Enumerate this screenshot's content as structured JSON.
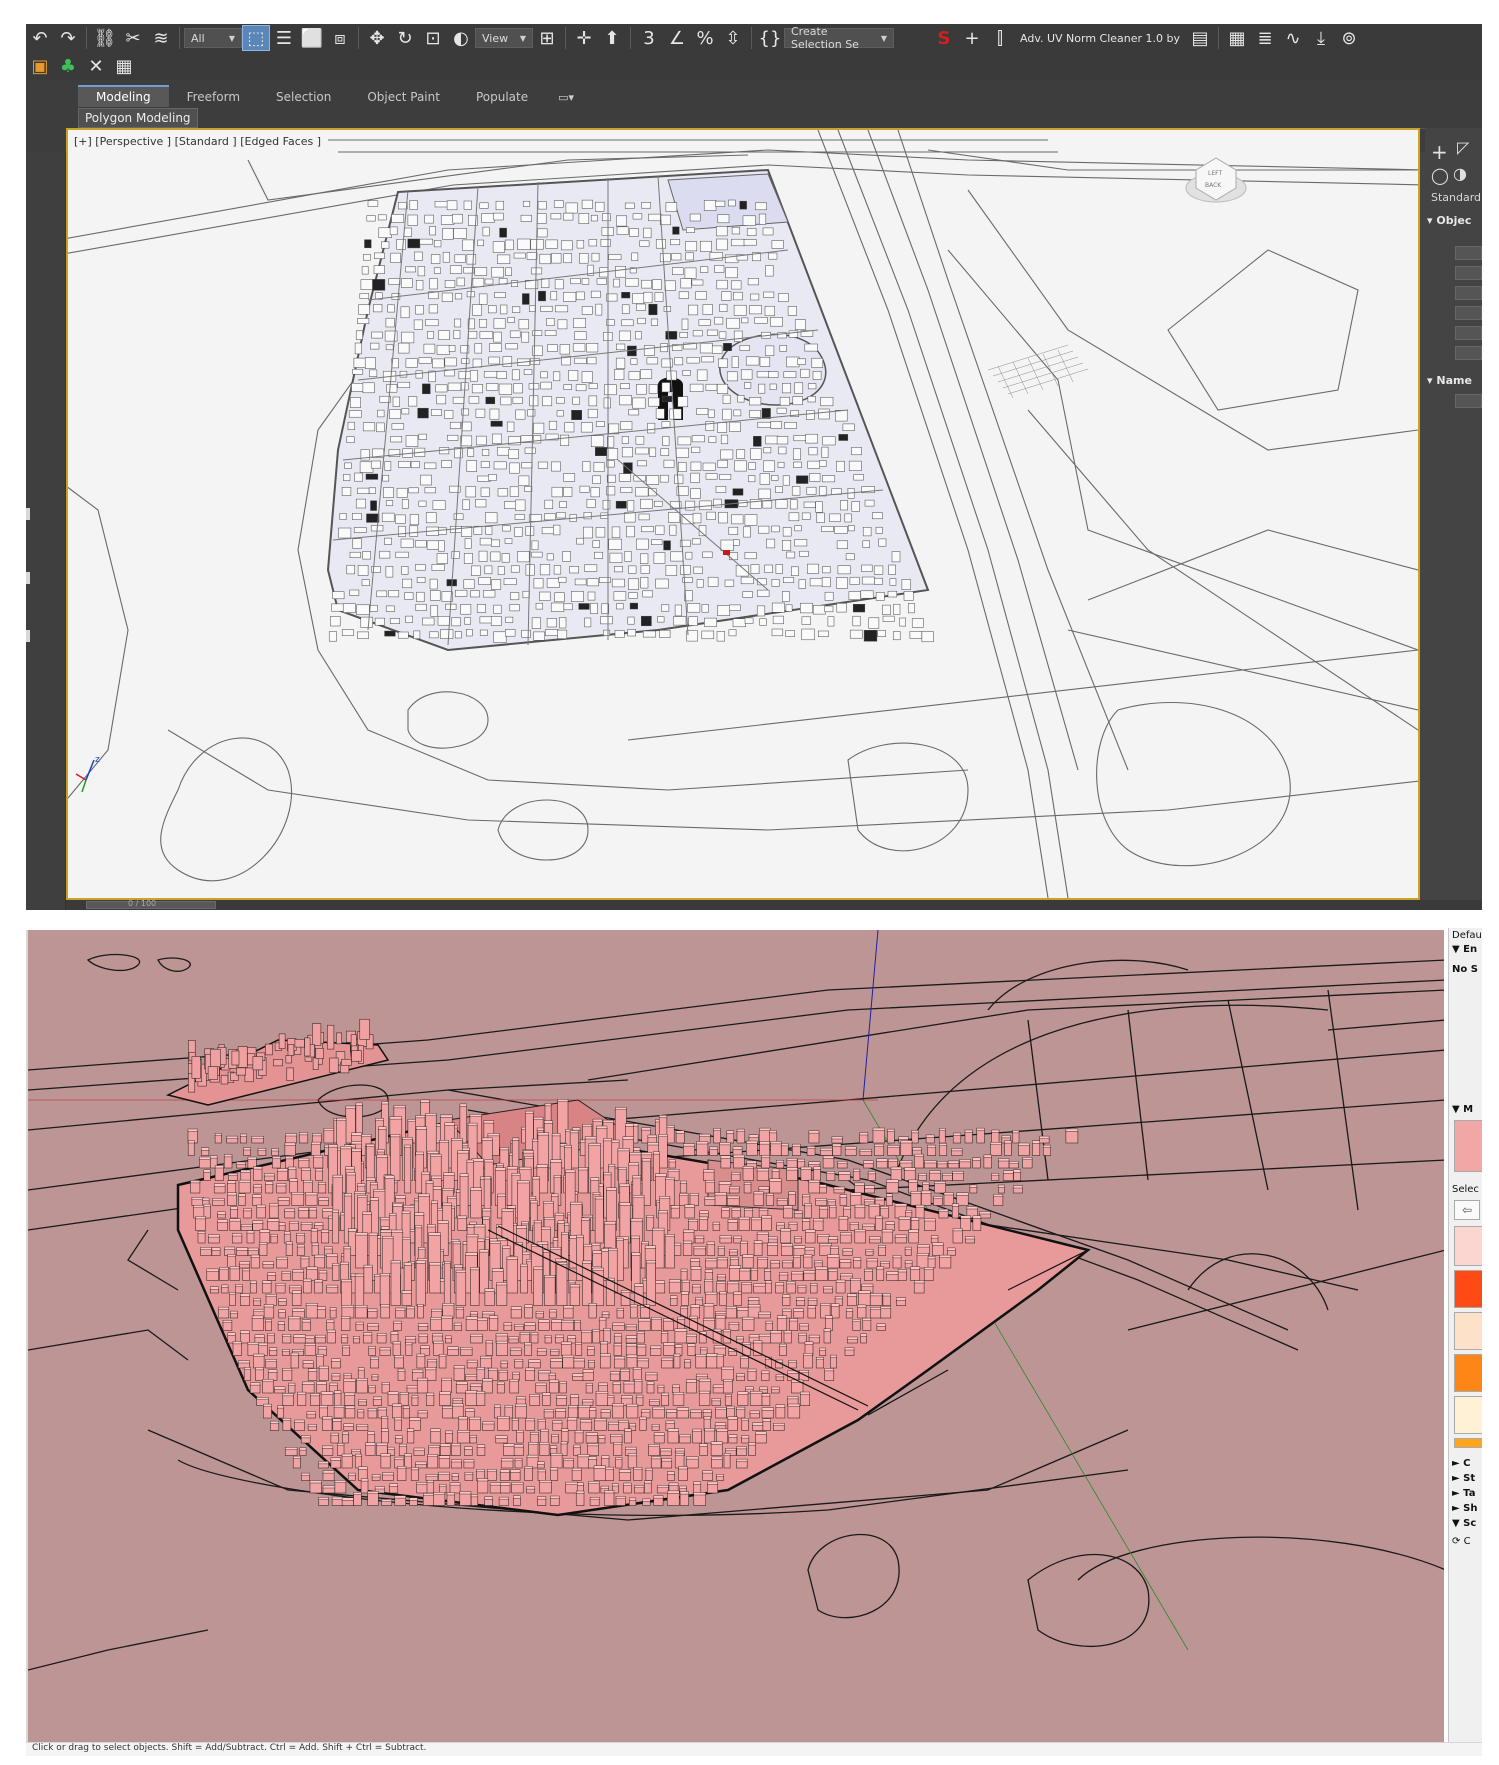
{
  "max": {
    "toolbar": {
      "selection_filter": "All",
      "ref_coord": "View",
      "named_selection": "Create Selection Se",
      "plugin_label": "Adv. UV Norm Cleaner 1.0 by"
    },
    "ribbon": {
      "tabs": [
        "Modeling",
        "Freeform",
        "Selection",
        "Object Paint",
        "Populate"
      ],
      "sub_label": "Polygon Modeling"
    },
    "viewport": {
      "label": "[+] [Perspective ] [Standard ] [Edged Faces ]"
    },
    "command_panel": {
      "dropdown": "Standard",
      "rollout_object": "Objec",
      "rollout_name": "Name"
    },
    "timeline": {
      "frame": "0 / 100"
    },
    "colors": {
      "accent": "#5b87b8",
      "viewport_border": "#c9a227",
      "toolbar_bg": "#3a3a3a"
    }
  },
  "sketchup": {
    "tray": {
      "header": "Defau",
      "entity_row": "En",
      "no_selection": "No S",
      "materials_row": "M",
      "select_label": "Selec",
      "rows": [
        "C",
        "St",
        "Ta",
        "Sh",
        "Sc"
      ],
      "last_row": "C"
    },
    "swatches": [
      "#f2a7a7",
      "#fbd5cf",
      "#fe4a14",
      "#fde1c8",
      "#fd8616",
      "#fef1d6",
      "#fda51e"
    ],
    "status": "Click or drag to select objects. Shift = Add/Subtract. Ctrl = Add. Shift + Ctrl = Subtract.",
    "colors": {
      "background": "#bd9595",
      "buildings": "#f0a0a0"
    }
  }
}
